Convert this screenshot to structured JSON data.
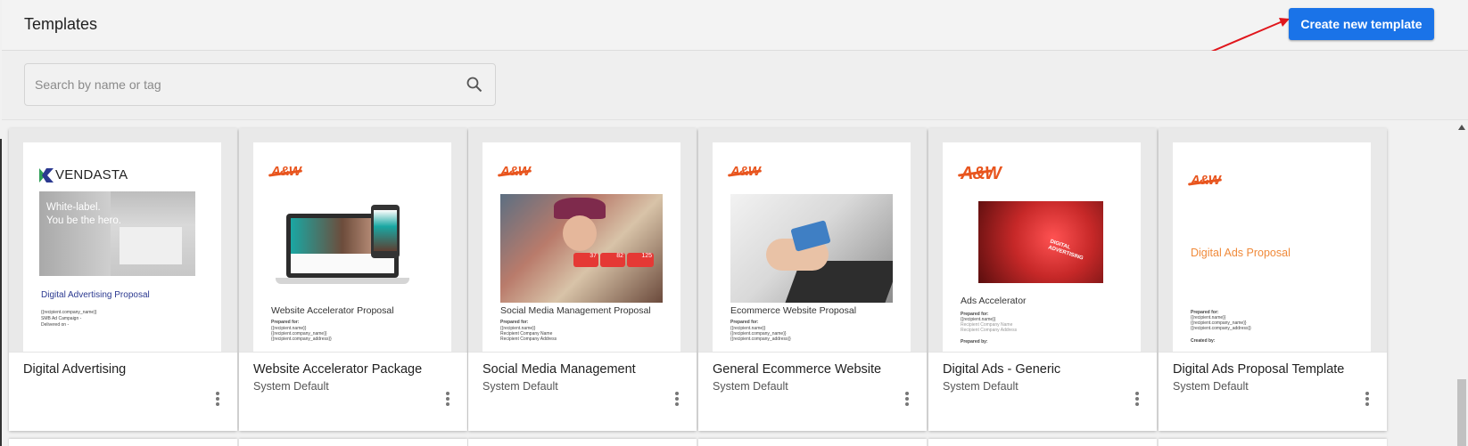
{
  "header": {
    "title": "Templates",
    "create_button_label": "Create new template"
  },
  "search": {
    "placeholder": "Search by name or tag",
    "value": ""
  },
  "cards": [
    {
      "name": "Digital Advertising",
      "subtitle": "",
      "preview": {
        "brand": "VENDASTA",
        "hero_text_line1": "White-label.",
        "hero_text_line2": "You be the hero.",
        "doc_title": "Digital Advertising Proposal",
        "lines": [
          "{{recipient.company_name}}",
          "SMB Ad Campaign -",
          "Delivered on -"
        ]
      }
    },
    {
      "name": "Website Accelerator Package",
      "subtitle": "System Default",
      "preview": {
        "logo": "A&W",
        "doc_title": "Website Accelerator Proposal",
        "prepared_for": "Prepared for:",
        "lines": [
          "{{recipient.name}}",
          "{{recipient.company_name}}",
          "{{recipient.company_address}}"
        ]
      }
    },
    {
      "name": "Social Media Management",
      "subtitle": "System Default",
      "preview": {
        "logo": "A&W",
        "doc_title": "Social Media Management Proposal",
        "prepared_for": "Prepared for:",
        "badge_1": "37",
        "badge_2": "82",
        "badge_3": "125",
        "lines": [
          "{{recipient.name}}",
          "Recipient Company Name",
          "Recipient Company Address"
        ]
      }
    },
    {
      "name": "General Ecommerce Website",
      "subtitle": "System Default",
      "preview": {
        "logo": "A&W",
        "doc_title": "Ecommerce Website Proposal",
        "prepared_for": "Prepared for:",
        "lines": [
          "{{recipient.name}}",
          "{{recipient.company_name}}",
          "{{recipient.company_address}}"
        ]
      }
    },
    {
      "name": "Digital Ads - Generic",
      "subtitle": "System Default",
      "preview": {
        "logo": "A&W",
        "image_label": "DIGITAL ADVERTISING",
        "doc_title": "Ads Accelerator",
        "prepared_for": "Prepared for:",
        "lines": [
          "{{recipient.name}}",
          "Recipient Company Name",
          "Recipient Company Address"
        ],
        "prepared_by": "Prepared by:"
      }
    },
    {
      "name": "Digital Ads Proposal Template",
      "subtitle": "System Default",
      "preview": {
        "logo": "A&W",
        "doc_title": "Digital Ads Proposal",
        "prepared_for": "Prepared for:",
        "lines": [
          "{{recipient.name}}",
          "{{recipient.company_name}}",
          "{{recipient.company_address}}"
        ],
        "created_by": "Created by:"
      }
    }
  ],
  "colors": {
    "primary_button": "#1a73e8",
    "annotation_arrow": "#e0161c",
    "brand_orange": "#e8551e",
    "vendasta_green": "#2e9e57",
    "vendasta_blue": "#2b3990"
  },
  "icons": {
    "search": "search-icon",
    "more": "more-vert-icon",
    "arrow": "annotation-arrow-icon"
  }
}
